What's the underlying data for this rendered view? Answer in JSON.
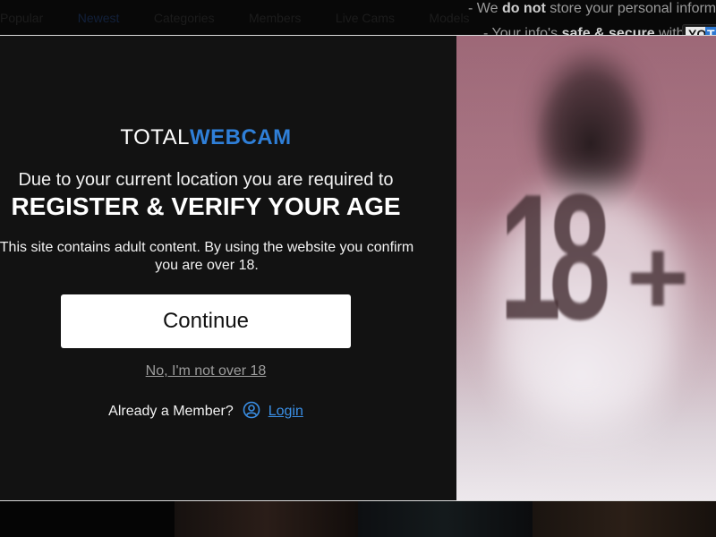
{
  "background": {
    "nav_items": [
      "Popular",
      "Newest",
      "Categories",
      "Members",
      "Live Cams",
      "Models"
    ],
    "notice_line1_prefix": "- We",
    "notice_line1_bold": "do not",
    "notice_line1_suffix": "store your personal informa",
    "notice_line2_prefix": "- Your info's",
    "notice_line2_bold": "safe & secure",
    "notice_line2_suffix": "with",
    "yoti_yo": "YO",
    "yoti_ti": "T"
  },
  "modal": {
    "logo_part1": "TOTAL",
    "logo_part2": "WEBCAM",
    "lead": "Due to your current location you are required to",
    "headline": "REGISTER & VERIFY YOUR AGE",
    "description": "This site contains adult content. By using the website you confirm you are over 18.",
    "continue_label": "Continue",
    "not_over_label": "No, I'm not over 18",
    "member_text": "Already a Member?",
    "login_label": "Login",
    "age_badge_number": "18",
    "age_badge_plus": "+"
  },
  "colors": {
    "panel_bg": "#121212",
    "accent_blue": "#2f7fd8",
    "link_blue": "#3a8fe6",
    "button_bg": "#ffffff"
  },
  "icons": [
    "user-circle-icon"
  ]
}
